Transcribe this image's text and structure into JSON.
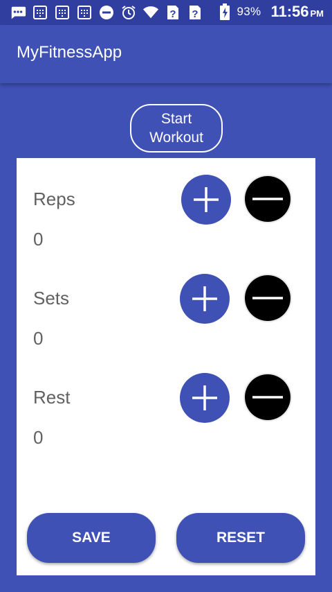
{
  "status_bar": {
    "battery_percent": "93%",
    "time": "11:56",
    "ampm": "PM",
    "left_icons": [
      "chat-bubble-icon",
      "calendar-icon",
      "calendar-icon",
      "calendar-icon",
      "do-not-disturb-icon",
      "alarm-icon",
      "wifi-icon",
      "sim-unknown-icon",
      "sim-unknown-icon",
      "battery-charging-icon"
    ]
  },
  "app_bar": {
    "title": "MyFitnessApp"
  },
  "start_button": {
    "label": "Start\nWorkout"
  },
  "counters": [
    {
      "label": "Reps",
      "value": "0"
    },
    {
      "label": "Sets",
      "value": "0"
    },
    {
      "label": "Rest",
      "value": "0"
    }
  ],
  "actions": {
    "save_label": "SAVE",
    "reset_label": "RESET"
  },
  "colors": {
    "primary": "#3f51b5",
    "primary_dark": "#303f9f",
    "minus_button": "#000000",
    "text": "#616161",
    "panel": "#ffffff"
  }
}
